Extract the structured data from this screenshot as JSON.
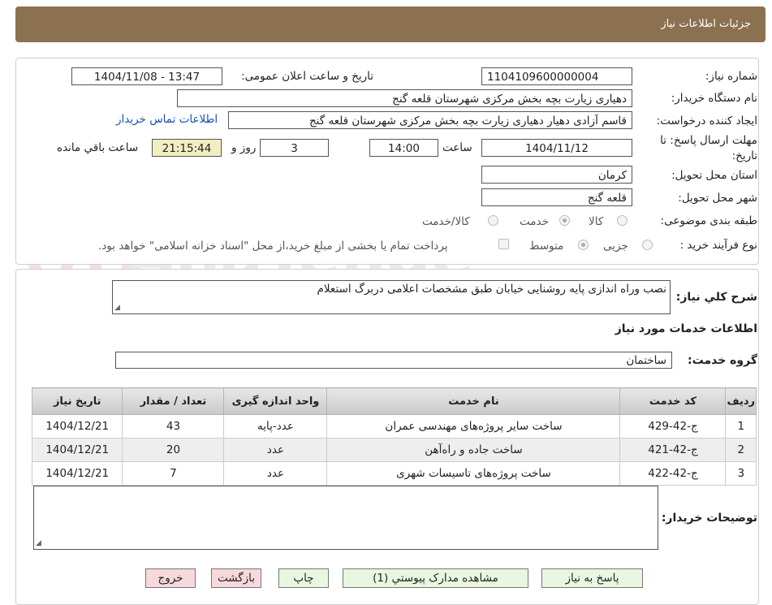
{
  "header": {
    "title": "جزئیات اطلاعات نیاز"
  },
  "form": {
    "need_number_label": "شماره نیاز:",
    "need_number": "1104109600000004",
    "announce_label": "تاریخ و ساعت اعلان عمومی:",
    "announce_value": "1404/11/08 - 13:47",
    "buyer_org_label": "نام دستگاه خریدار:",
    "buyer_org": "دهیاری زیارت بچه بخش مرکزی شهرستان قلعه گنج",
    "creator_label": "ایجاد کننده درخواست:",
    "creator": "قاسم آزادی دهیار دهیاری زیارت بچه بخش مرکزی شهرستان قلعه گنج",
    "contact_link": "اطلاعات تماس خریدار",
    "deadline_label_1": "مهلت ارسال پاسخ: تا",
    "deadline_label_2": "تاریخ:",
    "deadline_date": "1404/11/12",
    "time_label": "ساعت",
    "deadline_time": "14:00",
    "days_value": "3",
    "days_label": "روز و",
    "remaining_time": "21:15:44",
    "remaining_label": "ساعت باقي مانده",
    "province_label": "استان محل تحویل:",
    "province": "کرمان",
    "city_label": "شهر محل تحویل:",
    "city": "قلعه گنج",
    "category_label": "طبقه بندی موضوعی:",
    "category_options": [
      "کالا",
      "خدمت",
      "کالا/خدمت"
    ],
    "category_selected": "خدمت",
    "process_label": "نوع فرآیند خرید :",
    "process_options": [
      "جزیی",
      "متوسط"
    ],
    "process_selected": "متوسط",
    "payment_note": "پرداخت تمام یا بخشی از مبلغ خرید،از محل \"اسناد خزانه اسلامی\" خواهد بود."
  },
  "description": {
    "label": "شرح کلي نياز:",
    "value": "نصب وراه اندازی پایه روشنایی خیابان طبق مشخصات اعلامی دربرگ استعلام"
  },
  "services": {
    "section_title": "اطلاعات خدمات مورد نیاز",
    "group_label": "گروه خدمت:",
    "group_value": "ساختمان",
    "columns": [
      "ردیف",
      "کد خدمت",
      "نام خدمت",
      "واحد اندازه گیری",
      "تعداد / مقدار",
      "تاریخ نیاز"
    ],
    "rows": [
      {
        "row": "1",
        "code": "ج-42-429",
        "name": "ساخت سایر پروژه‌های مهندسی عمران",
        "unit": "عدد-پایه",
        "qty": "43",
        "date": "1404/12/21"
      },
      {
        "row": "2",
        "code": "ج-42-421",
        "name": "ساخت جاده و راه‌آهن",
        "unit": "عدد",
        "qty": "20",
        "date": "1404/12/21"
      },
      {
        "row": "3",
        "code": "ج-42-422",
        "name": "ساخت پروژه‌های تاسیسات شهری",
        "unit": "عدد",
        "qty": "7",
        "date": "1404/12/21"
      }
    ]
  },
  "buyer_notes": {
    "label": "توضیحات خریدار:",
    "value": ""
  },
  "buttons": {
    "reply": "پاسخ به نیاز",
    "attachments": "مشاهده مدارک پیوستي (1)",
    "print": "چاپ",
    "back": "بازگشت",
    "exit": "خروج"
  },
  "watermark": {
    "text": "AnaTender.net"
  },
  "colors": {
    "header_bg": "#8b7150",
    "remaining_bg": "#f2eec1",
    "button_green": "#e9f7e2",
    "button_red": "#f8d9db",
    "link": "#1a4fb5"
  }
}
